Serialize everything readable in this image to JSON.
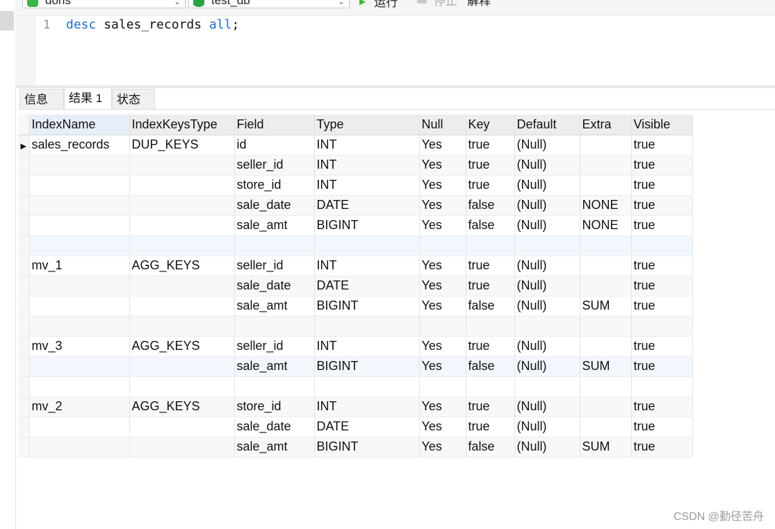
{
  "toolbar": {
    "connection": "doris",
    "database": "test_db",
    "run_label": "运行",
    "stop_label": "停止",
    "explain_label": "解释"
  },
  "editor": {
    "line_number": "1",
    "keyword_desc": "desc",
    "table_text": " sales_records ",
    "keyword_all": "all",
    "terminator": ";"
  },
  "tabs": [
    {
      "label": "信息"
    },
    {
      "label": "结果 1"
    },
    {
      "label": "状态"
    }
  ],
  "active_tab": "结果 1",
  "grid": {
    "columns": [
      "IndexName",
      "IndexKeysType",
      "Field",
      "Type",
      "Null",
      "Key",
      "Default",
      "Extra",
      "Visible"
    ],
    "rows": [
      [
        "sales_records",
        "DUP_KEYS",
        "id",
        "INT",
        "Yes",
        "true",
        "(Null)",
        "",
        "true"
      ],
      [
        "",
        "",
        "seller_id",
        "INT",
        "Yes",
        "true",
        "(Null)",
        "",
        "true"
      ],
      [
        "",
        "",
        "store_id",
        "INT",
        "Yes",
        "true",
        "(Null)",
        "",
        "true"
      ],
      [
        "",
        "",
        "sale_date",
        "DATE",
        "Yes",
        "false",
        "(Null)",
        "NONE",
        "true"
      ],
      [
        "",
        "",
        "sale_amt",
        "BIGINT",
        "Yes",
        "false",
        "(Null)",
        "NONE",
        "true"
      ],
      [
        "",
        "",
        "",
        "",
        "",
        "",
        "",
        "",
        ""
      ],
      [
        "mv_1",
        "AGG_KEYS",
        "seller_id",
        "INT",
        "Yes",
        "true",
        "(Null)",
        "",
        "true"
      ],
      [
        "",
        "",
        "sale_date",
        "DATE",
        "Yes",
        "true",
        "(Null)",
        "",
        "true"
      ],
      [
        "",
        "",
        "sale_amt",
        "BIGINT",
        "Yes",
        "false",
        "(Null)",
        "SUM",
        "true"
      ],
      [
        "",
        "",
        "",
        "",
        "",
        "",
        "",
        "",
        ""
      ],
      [
        "mv_3",
        "AGG_KEYS",
        "seller_id",
        "INT",
        "Yes",
        "true",
        "(Null)",
        "",
        "true"
      ],
      [
        "",
        "",
        "sale_amt",
        "BIGINT",
        "Yes",
        "false",
        "(Null)",
        "SUM",
        "true"
      ],
      [
        "",
        "",
        "",
        "",
        "",
        "",
        "",
        "",
        ""
      ],
      [
        "mv_2",
        "AGG_KEYS",
        "store_id",
        "INT",
        "Yes",
        "true",
        "(Null)",
        "",
        "true"
      ],
      [
        "",
        "",
        "sale_date",
        "DATE",
        "Yes",
        "true",
        "(Null)",
        "",
        "true"
      ],
      [
        "",
        "",
        "sale_amt",
        "BIGINT",
        "Yes",
        "false",
        "(Null)",
        "SUM",
        "true"
      ]
    ]
  },
  "watermark": "CSDN @勤径苦舟"
}
